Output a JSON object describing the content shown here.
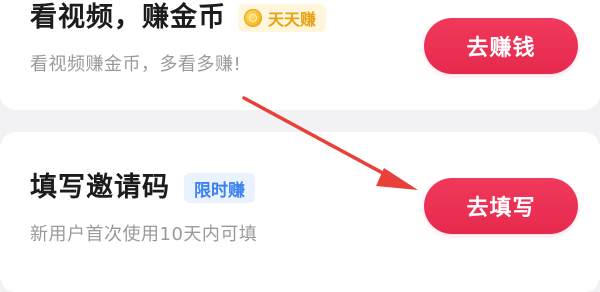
{
  "tasks": [
    {
      "title": "看视频，赚金币",
      "badge": "天天赚",
      "badge_icon": "coin-icon",
      "subtitle": "看视频赚金币，多看多赚!",
      "button": "去赚钱"
    },
    {
      "title": "填写邀请码",
      "badge": "限时赚",
      "subtitle": "新用户首次使用10天内可填",
      "button": "去填写"
    }
  ],
  "colors": {
    "button": "#e62a4e",
    "badge_gold_text": "#e5a215",
    "badge_gold_bg": "#fff6dc",
    "badge_blue_text": "#3b82f0",
    "badge_blue_bg": "#eaf2ff",
    "annotation_arrow": "#e8413a"
  }
}
